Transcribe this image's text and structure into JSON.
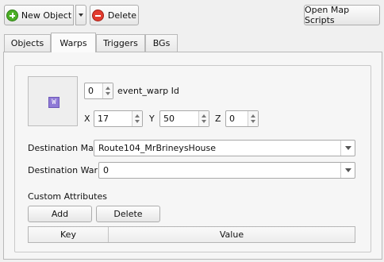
{
  "toolbar": {
    "new_object_label": "New Object",
    "delete_label": "Delete",
    "open_map_scripts_label": "Open Map Scripts"
  },
  "tabs": [
    {
      "label": "Objects"
    },
    {
      "label": "Warps"
    },
    {
      "label": "Triggers"
    },
    {
      "label": "BGs"
    }
  ],
  "event": {
    "sprite_glyph": "W",
    "id_value": "0",
    "id_label": "event_warp Id",
    "x_label": "X",
    "x_value": "17",
    "y_label": "Y",
    "y_value": "50",
    "z_label": "Z",
    "z_value": "0"
  },
  "destination": {
    "map_label": "Destination Map",
    "map_value": "Route104_MrBrineysHouse",
    "warp_label": "Destination Warp",
    "warp_value": "0"
  },
  "custom_attributes": {
    "title": "Custom Attributes",
    "add_label": "Add",
    "delete_label": "Delete",
    "columns": [
      "Key",
      "Value"
    ]
  }
}
